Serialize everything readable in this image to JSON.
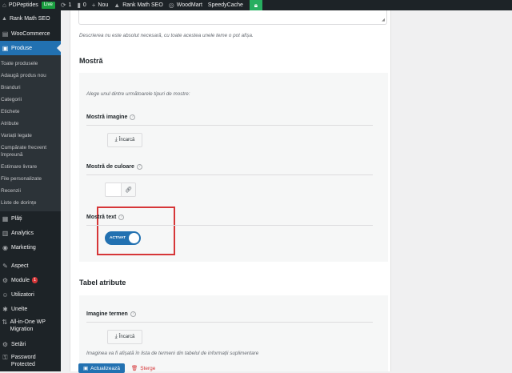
{
  "adminbar": {
    "site_name": "PDPeptides",
    "live_badge": "Live",
    "updates_count": "1",
    "comments_count": "0",
    "new_label": "Nou",
    "rank_math": "Rank Math SEO",
    "woodmart": "WoodMart",
    "speedycache": "SpeedyCache"
  },
  "sidebar": {
    "top_item": "Rank Math SEO",
    "woocommerce": "WooCommerce",
    "produse": "Produse",
    "submenu": [
      "Toate produsele",
      "Adaugă produs nou",
      "Branduri",
      "Categorii",
      "Etichete",
      "Atribute",
      "Variații legate",
      "Cumpărate frecvent împreună",
      "Estimare livrare",
      "File personalizate",
      "Recenzii",
      "Liste de dorințe"
    ],
    "platis": "Plăți",
    "analytics": "Analytics",
    "marketing": "Marketing",
    "aspect": "Aspect",
    "module": "Module",
    "module_badge": "1",
    "utilizatori": "Utilizatori",
    "unelte": "Unelte",
    "aio": "All-in-One WP Migration",
    "setari": "Setări",
    "password": "Password Protected"
  },
  "main": {
    "desc_note": "Descrierea nu este absolut necesară, cu toate acestea unele teme o pot afișa.",
    "swatch_section": "Mostră",
    "swatch_intro": "Alege unul dintre următoarele tipuri de mostre:",
    "image_label": "Mostră imagine",
    "upload_label": "Încarcă",
    "color_label": "Mostră de culoare",
    "text_label": "Mostră text",
    "toggle_label": "ACTIVAT",
    "attr_section": "Tabel atribute",
    "term_image_label": "Imagine termen",
    "term_upload_label": "Încarcă",
    "term_note": "Imaginea va fi afișată în lista de termeni din tabelul de informații suplimentare",
    "update_button": "Actualizează",
    "delete_link": "Șterge"
  }
}
